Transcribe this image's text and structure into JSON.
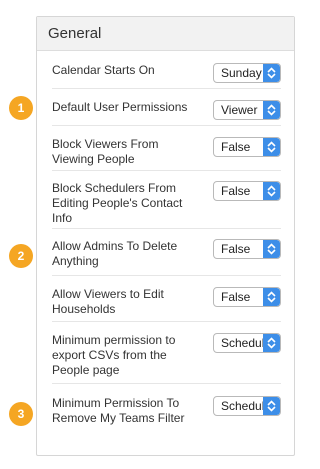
{
  "panel": {
    "title": "General"
  },
  "settings": [
    {
      "label": "Calendar Starts On",
      "value": "Sunday"
    },
    {
      "label": "Default User Permissions",
      "value": "Viewer",
      "badge": "1"
    },
    {
      "label": "Block Viewers From Viewing People",
      "value": "False"
    },
    {
      "label": "Block Schedulers From Editing People's Contact Info",
      "value": "False"
    },
    {
      "label": "Allow Admins To Delete Anything",
      "value": "False",
      "badge": "2"
    },
    {
      "label": "Allow Viewers to Edit Households",
      "value": "False"
    },
    {
      "label": "Minimum permission to export CSVs from the People page",
      "value": "Scheduler"
    },
    {
      "label": "Minimum Permission To Remove My Teams Filter",
      "value": "Scheduler",
      "badge": "3"
    }
  ],
  "colors": {
    "badge": "#f5a623",
    "select_accent": "#3d8ee8"
  },
  "icons": {
    "select_arrows": "chevron-up-down-icon"
  }
}
